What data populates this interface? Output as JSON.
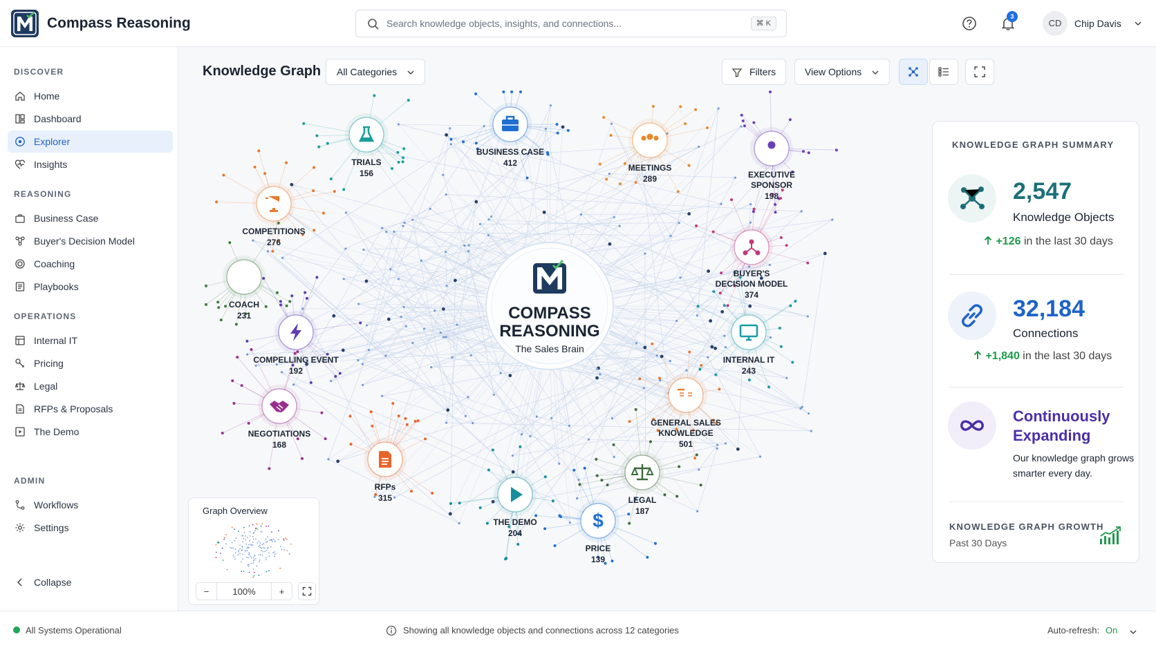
{
  "app": {
    "title": "Compass Reasoning",
    "logo_letter": "M"
  },
  "search": {
    "placeholder": "Search knowledge objects, insights, and connections...",
    "shortcut": "⌘ K"
  },
  "header": {
    "notifications_count": "3",
    "user_initials": "CD",
    "user_name": "Chip Davis"
  },
  "sidebar": {
    "sections": [
      {
        "title": "DISCOVER",
        "items": [
          {
            "label": "Home",
            "icon": "home-icon"
          },
          {
            "label": "Dashboard",
            "icon": "dashboard-icon"
          },
          {
            "label": "Explorer",
            "icon": "compass-icon",
            "active": true
          },
          {
            "label": "Insights",
            "icon": "insights-icon"
          }
        ]
      },
      {
        "title": "REASONING",
        "items": [
          {
            "label": "Business Case",
            "icon": "business-case-icon"
          },
          {
            "label": "Buyer's Decision Model",
            "icon": "decision-model-icon"
          },
          {
            "label": "Coaching",
            "icon": "coaching-icon"
          },
          {
            "label": "Playbooks",
            "icon": "playbooks-icon"
          }
        ]
      },
      {
        "title": "OPERATIONS",
        "items": [
          {
            "label": "Internal IT",
            "icon": "internal-it-icon"
          },
          {
            "label": "Pricing",
            "icon": "pricing-icon"
          },
          {
            "label": "Legal",
            "icon": "legal-icon"
          },
          {
            "label": "RFPs & Proposals",
            "icon": "rfps-icon"
          },
          {
            "label": "The Demo",
            "icon": "demo-icon"
          }
        ]
      },
      {
        "title": "ADMIN",
        "items": [
          {
            "label": "Workflows",
            "icon": "workflows-icon"
          },
          {
            "label": "Settings",
            "icon": "settings-icon"
          }
        ]
      }
    ],
    "collapse_label": "Collapse"
  },
  "main": {
    "title": "Knowledge Graph",
    "category_select": "All Categories",
    "filters_label": "Filters",
    "view_options_label": "View Options"
  },
  "graph": {
    "center": {
      "line1": "COMPASS",
      "line2": "REASONING",
      "tagline": "The Sales Brain"
    },
    "nodes": [
      {
        "name": "trials",
        "label_lines": [
          "TRIALS"
        ],
        "count": "156",
        "color": "#1a9e9a",
        "icon": "flask-icon"
      },
      {
        "name": "business-case",
        "label_lines": [
          "BUSINESS CASE"
        ],
        "count": "412",
        "color": "#1f6fd1",
        "icon": "briefcase-icon"
      },
      {
        "name": "meetings",
        "label_lines": [
          "MEETINGS"
        ],
        "count": "289",
        "color": "#e8892a",
        "icon": "people-icon"
      },
      {
        "name": "executive-sponsor",
        "label_lines": [
          "EXECUTIVE",
          "SPONSOR"
        ],
        "count": "198",
        "color": "#6a3fb5",
        "icon": "person-icon"
      },
      {
        "name": "competitions",
        "label_lines": [
          "COMPETITIONS"
        ],
        "count": "276",
        "color": "#e8772a",
        "icon": "trophy-icon"
      },
      {
        "name": "buyers-decision-model",
        "label_lines": [
          "BUYER'S",
          "DECISION MODEL"
        ],
        "count": "374",
        "color": "#c2387a",
        "icon": "decision-network-icon"
      },
      {
        "name": "coach",
        "label_lines": [
          "COACH"
        ],
        "count": "231",
        "color": "#3d7d3a",
        "icon": "whistle-icon"
      },
      {
        "name": "internal-it",
        "label_lines": [
          "INTERNAL IT"
        ],
        "count": "243",
        "color": "#1a9aa8",
        "icon": "monitor-icon"
      },
      {
        "name": "compelling-event",
        "label_lines": [
          "COMPELLING EVENT"
        ],
        "count": "192",
        "color": "#5b3db0",
        "icon": "bolt-icon"
      },
      {
        "name": "general-sales-knowledge",
        "label_lines": [
          "GENERAL SALES",
          "KNOWLEDGE"
        ],
        "count": "501",
        "color": "#e8772a",
        "icon": "book-icon"
      },
      {
        "name": "negotiations",
        "label_lines": [
          "NEGOTIATIONS"
        ],
        "count": "168",
        "color": "#9a2f8f",
        "icon": "handshake-icon"
      },
      {
        "name": "rfps",
        "label_lines": [
          "RFPs"
        ],
        "count": "315",
        "color": "#e8652a",
        "icon": "document-icon"
      },
      {
        "name": "legal",
        "label_lines": [
          "LEGAL"
        ],
        "count": "187",
        "color": "#3d6b3a",
        "icon": "scales-icon"
      },
      {
        "name": "the-demo",
        "label_lines": [
          "THE DEMO"
        ],
        "count": "204",
        "color": "#1a8ea0",
        "icon": "play-icon"
      },
      {
        "name": "price",
        "label_lines": [
          "PRICE"
        ],
        "count": "139",
        "color": "#1f6fd1",
        "icon": "dollar-icon"
      }
    ]
  },
  "overview": {
    "title": "Graph Overview",
    "zoom": "100%",
    "zoom_out": "−",
    "zoom_in": "+"
  },
  "summary": {
    "title": "KNOWLEDGE GRAPH SUMMARY",
    "objects_value": "2,547",
    "objects_label": "Knowledge Objects",
    "objects_delta": "+126",
    "objects_delta_text": "in the last 30 days",
    "connections_value": "32,184",
    "connections_label": "Connections",
    "connections_delta": "+1,840",
    "connections_delta_text": "in the last 30 days",
    "expanding_title": "Continuously Expanding",
    "expanding_desc": "Our knowledge graph grows smarter every day.",
    "growth_title": "KNOWLEDGE GRAPH GROWTH",
    "growth_sub": "Past 30 Days",
    "accent_objects": "#1b6f78",
    "accent_connections": "#1f63c9",
    "accent_expanding": "#4b2fa8",
    "accent_up": "#1e9a4a"
  },
  "status": {
    "system": "All Systems Operational",
    "center_text": "Showing all knowledge objects and connections across 12 categories",
    "auto_refresh_label": "Auto-refresh:",
    "auto_refresh_value": "On"
  }
}
